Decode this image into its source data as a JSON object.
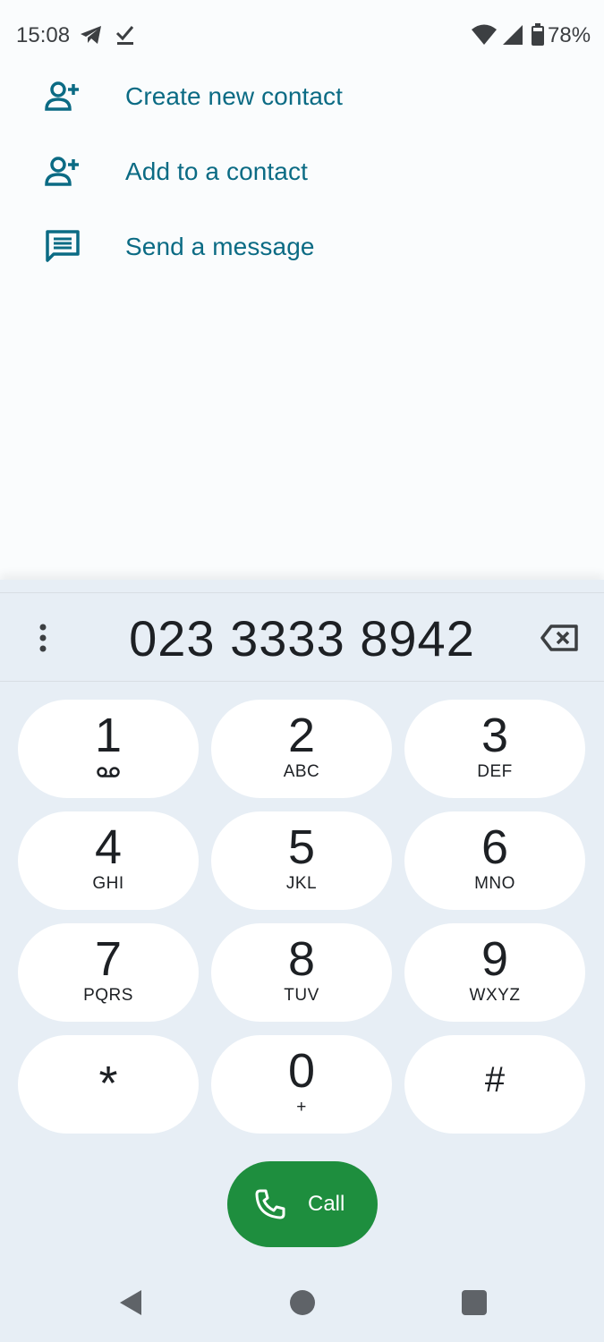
{
  "status_bar": {
    "time": "15:08",
    "battery_percent": "78%",
    "icons": [
      "telegram-icon",
      "checkmark-icon",
      "wifi-icon",
      "signal-icon",
      "battery-icon"
    ]
  },
  "suggestions": [
    {
      "label": "Create new contact",
      "icon": "add-person-icon"
    },
    {
      "label": "Add to a contact",
      "icon": "add-person-icon"
    },
    {
      "label": "Send a message",
      "icon": "message-icon"
    }
  ],
  "dialpad": {
    "number": "023 3333 8942",
    "keys": [
      {
        "digit": "1",
        "letters": ""
      },
      {
        "digit": "2",
        "letters": "ABC"
      },
      {
        "digit": "3",
        "letters": "DEF"
      },
      {
        "digit": "4",
        "letters": "GHI"
      },
      {
        "digit": "5",
        "letters": "JKL"
      },
      {
        "digit": "6",
        "letters": "MNO"
      },
      {
        "digit": "7",
        "letters": "PQRS"
      },
      {
        "digit": "8",
        "letters": "TUV"
      },
      {
        "digit": "9",
        "letters": "WXYZ"
      },
      {
        "digit": "*",
        "letters": ""
      },
      {
        "digit": "0",
        "letters": "+"
      },
      {
        "digit": "#",
        "letters": ""
      }
    ],
    "call_label": "Call"
  },
  "colors": {
    "accent": "#0b6b84",
    "call_green": "#1e8e3e",
    "dialpad_bg": "#e7eef5"
  }
}
